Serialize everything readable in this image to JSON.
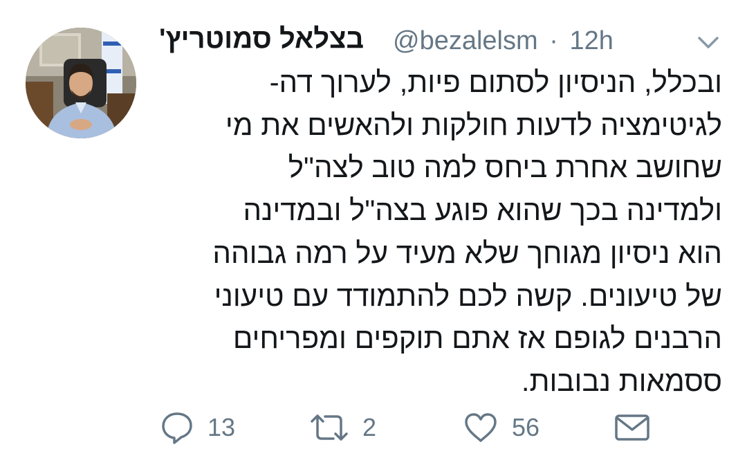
{
  "tweet": {
    "author": {
      "display_name": "בצלאל סמוטריץ'",
      "handle": "@bezalelsm",
      "separator": "·",
      "time": "12h",
      "avatar": "profile-photo"
    },
    "menu_icon": "chevron-down-icon",
    "text_lines": [
      "ובכלל, הניסיון לסתום פיות, לערוך דה-",
      "לגיטימציה לדעות חולקות ולהאשים את מי",
      "שחושב אחרת ביחס למה טוב לצה\"ל",
      "ולמדינה בכך שהוא פוגע בצה\"ל ובמדינה",
      "הוא ניסיון מגוחך שלא מעיד על רמה גבוהה",
      "של טיעונים. קשה לכם להתמודד עם טיעוני",
      "הרבנים לגופם אז אתם תוקפים ומפריחים",
      "ססמאות נבובות."
    ],
    "actions": {
      "reply": {
        "icon": "reply-icon",
        "count": "13"
      },
      "retweet": {
        "icon": "retweet-icon",
        "count": "2"
      },
      "like": {
        "icon": "heart-icon",
        "count": "56"
      },
      "share": {
        "icon": "envelope-icon"
      }
    },
    "colors": {
      "text": "#14171a",
      "secondary": "#657786"
    }
  }
}
